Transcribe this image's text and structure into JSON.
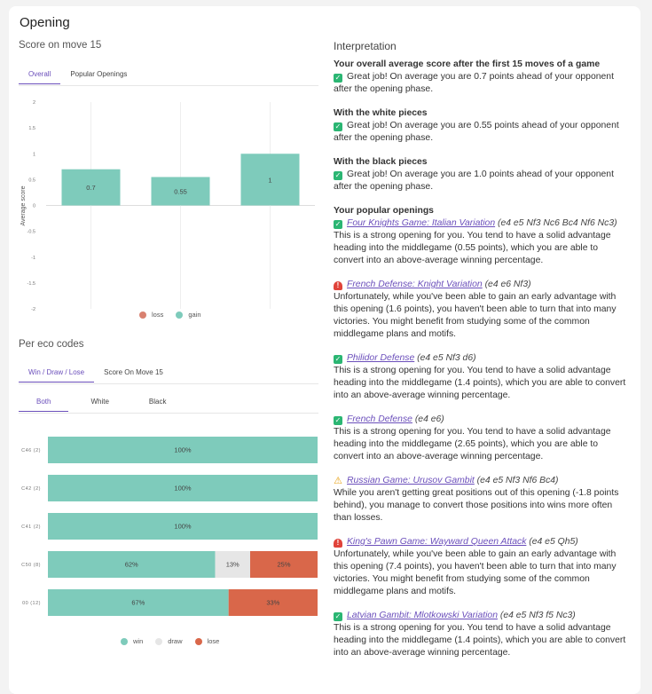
{
  "title": "Opening",
  "score": {
    "section_title": "Score on move 15",
    "tabs": [
      "Overall",
      "Popular Openings"
    ],
    "active_tab": 0,
    "chart_data": {
      "type": "bar",
      "categories": [
        "",
        "",
        ""
      ],
      "values": [
        0.7,
        0.55,
        1
      ],
      "data_labels": [
        "0.7",
        "0.55",
        "1"
      ],
      "ylabel": "Average score",
      "ylim": [
        -2,
        2
      ],
      "yticks": [
        "2",
        "1.5",
        "1",
        "0.5",
        "0",
        "-0.5",
        "-1",
        "-1.5",
        "-2"
      ],
      "legend": [
        "loss",
        "gain"
      ],
      "colors": {
        "loss": "#d98170",
        "gain": "#7ecbbb"
      }
    }
  },
  "eco": {
    "section_title": "Per eco codes",
    "tabs": [
      "Win / Draw / Lose",
      "Score On Move 15"
    ],
    "active_tab": 0,
    "subtabs": [
      "Both",
      "White",
      "Black"
    ],
    "active_subtab": 0,
    "chart_data": {
      "type": "bar",
      "orientation": "horizontal",
      "stacked": true,
      "categories": [
        "C46 (2)",
        "C42 (2)",
        "C41 (2)",
        "C50 (8)",
        "00 (12)"
      ],
      "series": [
        {
          "name": "win",
          "values": [
            100,
            100,
            100,
            62,
            67
          ],
          "labels": [
            "100%",
            "100%",
            "100%",
            "62%",
            "67%"
          ]
        },
        {
          "name": "draw",
          "values": [
            0,
            0,
            0,
            13,
            0
          ],
          "labels": [
            "",
            "",
            "",
            "13%",
            ""
          ]
        },
        {
          "name": "lose",
          "values": [
            0,
            0,
            0,
            25,
            33
          ],
          "labels": [
            "",
            "",
            "",
            "25%",
            "33%"
          ]
        }
      ],
      "colors": {
        "win": "#7ecbbb",
        "draw": "#e6e6e6",
        "lose": "#d9674a"
      }
    }
  },
  "interpretation": {
    "title": "Interpretation",
    "blocks": [
      {
        "title": "Your overall average score after the first 15 moves of a game",
        "text": "Great job! On average you are 0.7 points ahead of your opponent after the opening phase."
      },
      {
        "title": "With the white pieces",
        "text": "Great job! On average you are 0.55 points ahead of your opponent after the opening phase."
      },
      {
        "title": "With the black pieces",
        "text": "Great job! On average you are 1.0 points ahead of your opponent after the opening phase."
      }
    ],
    "popular_title": "Your popular openings",
    "openings": [
      {
        "icon": "check",
        "name": "Four Knights Game: Italian Variation",
        "moves": "(e4 e5 Nf3 Nc6 Bc4 Nf6 Nc3)",
        "text": "This is a strong opening for you. You tend to have a solid advantage heading into the middlegame (0.55 points), which you are able to convert into an above-average winning percentage."
      },
      {
        "icon": "alert",
        "name": "French Defense: Knight Variation",
        "moves": "(e4 e6 Nf3)",
        "text": "Unfortunately, while you've been able to gain an early advantage with this opening (1.6 points), you haven't been able to turn that into many victories. You might benefit from studying some of the common middlegame plans and motifs."
      },
      {
        "icon": "check",
        "name": "Philidor Defense",
        "moves": "(e4 e5 Nf3 d6)",
        "text": "This is a strong opening for you. You tend to have a solid advantage heading into the middlegame (1.4 points), which you are able to convert into an above-average winning percentage."
      },
      {
        "icon": "check",
        "name": "French Defense",
        "moves": "(e4 e6)",
        "text": "This is a strong opening for you. You tend to have a solid advantage heading into the middlegame (2.65 points), which you are able to convert into an above-average winning percentage."
      },
      {
        "icon": "warn",
        "name": "Russian Game: Urusov Gambit",
        "moves": "(e4 e5 Nf3 Nf6 Bc4)",
        "text": "While you aren't getting great positions out of this opening (-1.8 points behind), you manage to convert those positions into wins more often than losses."
      },
      {
        "icon": "alert",
        "name": "King's Pawn Game: Wayward Queen Attack",
        "moves": "(e4 e5 Qh5)",
        "text": "Unfortunately, while you've been able to gain an early advantage with this opening (7.4 points), you haven't been able to turn that into many victories. You might benefit from studying some of the common middlegame plans and motifs."
      },
      {
        "icon": "check",
        "name": "Latvian Gambit: Mlotkowski Variation",
        "moves": "(e4 e5 Nf3 f5 Nc3)",
        "text": "This is a strong opening for you. You tend to have a solid advantage heading into the middlegame (1.4 points), which you are able to convert into an above-average winning percentage."
      }
    ]
  }
}
